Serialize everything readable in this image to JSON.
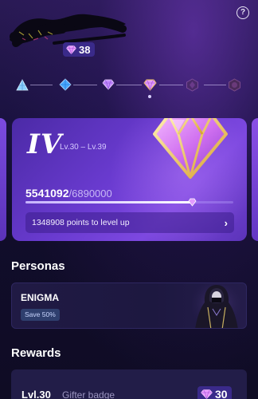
{
  "header": {
    "help_icon": "question-mark",
    "gem_balance": "38"
  },
  "tiers": {
    "items": [
      {
        "icon": "triangle-tier-icon",
        "state": "unlocked"
      },
      {
        "icon": "diamond-blue-tier-icon",
        "state": "unlocked"
      },
      {
        "icon": "gem-purple-tier-icon",
        "state": "unlocked"
      },
      {
        "icon": "gem-gold-tier-icon",
        "state": "current"
      },
      {
        "icon": "hex-locked-tier-icon",
        "state": "locked"
      },
      {
        "icon": "hex-locked-tier-icon",
        "state": "locked"
      }
    ]
  },
  "level_card": {
    "tier_numeral": "IV",
    "level_range": "Lv.30 – Lv.39",
    "points_current": "5541092",
    "points_total": "/6890000",
    "progress_fraction": 0.804,
    "levelup_text": "1348908 points to level up"
  },
  "personas": {
    "title": "Personas",
    "item": {
      "name": "ENIGMA",
      "discount": "Save 50%"
    }
  },
  "rewards": {
    "title": "Rewards",
    "item": {
      "level": "Lvl.30",
      "name": "Gifter badge",
      "cost": "30"
    }
  },
  "colors": {
    "background": "#0f0c24",
    "card_purple": "#6a3bd0",
    "badge_bg": "#3a2a8a",
    "gem_pink": "#d98cff",
    "gem_gold": "#f0c860"
  }
}
